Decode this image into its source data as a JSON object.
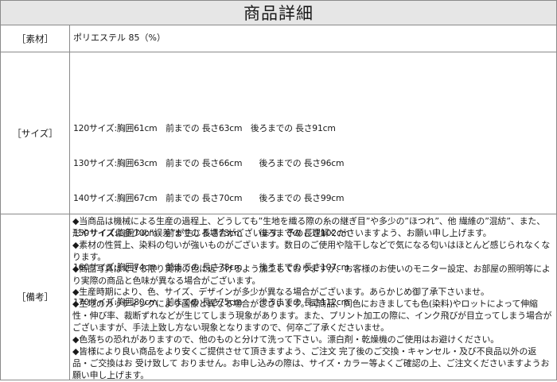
{
  "title": "商品詳細",
  "material": {
    "label": "［素材］",
    "value": "ポリエステル 85（%）"
  },
  "sizes": {
    "label": "［サイズ］",
    "lines": [
      "120サイズ:胸囲61cm　前までの 長さ63cm　後ろまでの 長さ91cm",
      "130サイズ:胸囲63cm　前までの 長さ66cm　　後ろまでの 長さ96cm",
      "140サイズ:胸囲67cm　前までの 長さ70cm　　後ろまでの 長さ99cm",
      "150サイズ:胸囲70cm　前までの 長さ73cm　　後ろまでの 長さ102cm",
      "160サイズ:胸囲74cm　前までの 長さ78cm　　後ろまでの 長さ107cm",
      "170サイズ:胸囲80cm　前までの 長さ75cm　　後ろまでの 長さ112cm"
    ]
  },
  "notes": {
    "label": "［備考］",
    "items": [
      "◆当商品は機械による生産の過程上、どうしても”生地を織る際の糸の継ぎ目”や多少の”ほつれ”、他 繊維の”混紡”、また、形やサイズに多少の”誤差”が生じる場合がございます。予めご理解くださいますよう、お願い申し上げます。",
      "◆素材の性質上、染料の匂いが強いものがございます。数日のご使用や陰干しなどで気になる匂いはほとんど感じられなくなります。",
      "◆商品写真はできる限り実物の色に近づけるよう加工しておりますが、お客様のお使いのモニター設定、お部屋の照明等により実際の商品と色味が異なる場合がございます。",
      "◆生産時期により、色、サイズ、デザインが多少が異なる場合がございます。あらかじめ御了承下さいませ。",
      "◆生地のカッティングにより画像と異なる場合がございます。同商品、同色におきましても色(染料)やロットによって伸縮性・伸び率、裁断ずれなどが生じてしまう現象があります。また、プリント加工の際に、インク飛びが目立ってしまう場合がございますが、手法上致し方ない現象となりますので、何卒ご了承くださいませ。",
      "◆色落ちの恐れがありますので、他のものと分けて洗って下さい。漂白剤・乾燥機のご使用はお避けください。",
      "◆皆様により良い商品をより安くご提供させて頂きますよう、ご注文 完了後のご交換・キャンセル・及び不良品以外の返品・ご交換はお 受け致して おりません。お申し込みの際は、サイズ・カラー等よくご確認の上、ご注文くださいますようお願い申し上げます。"
    ]
  }
}
